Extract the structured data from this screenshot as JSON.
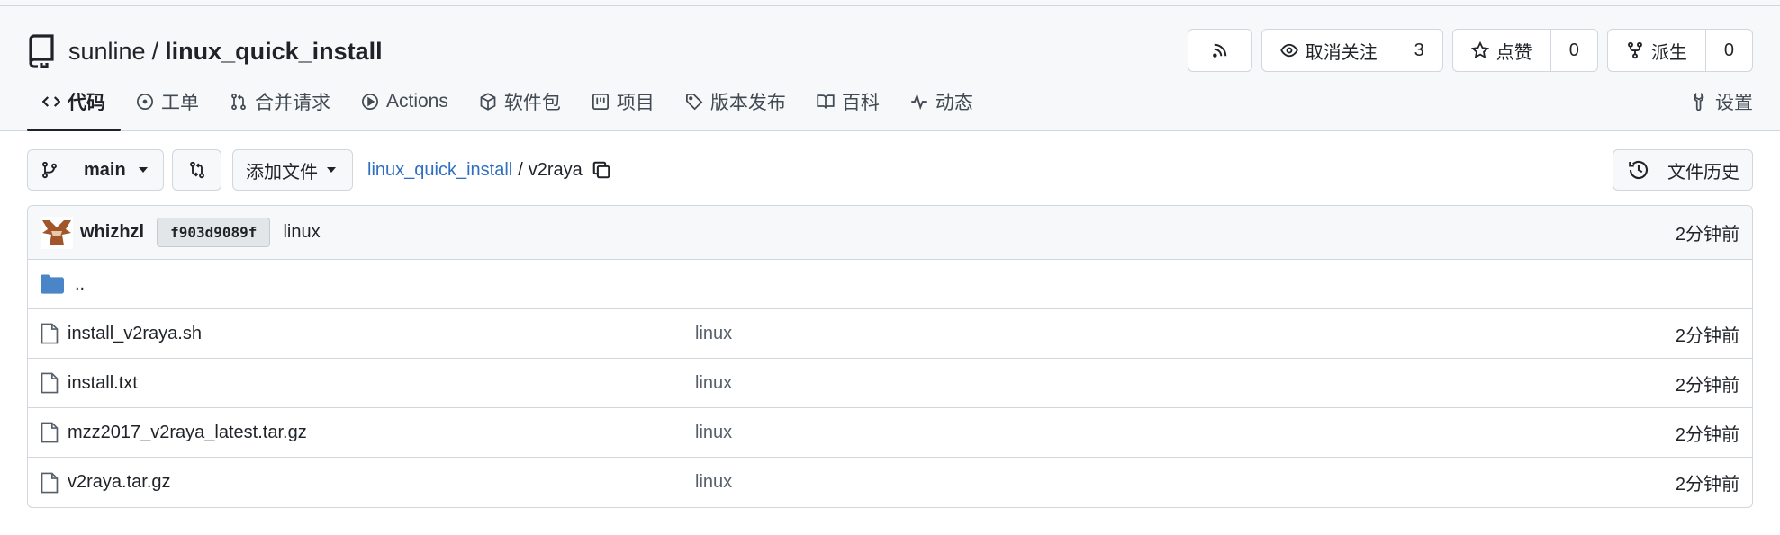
{
  "repo": {
    "owner": "sunline",
    "separator": "/",
    "name": "linux_quick_install"
  },
  "actions": {
    "unwatch_label": "取消关注",
    "watch_count": "3",
    "star_label": "点赞",
    "star_count": "0",
    "fork_label": "派生",
    "fork_count": "0"
  },
  "tabs": [
    {
      "label": "代码",
      "icon": "code-icon"
    },
    {
      "label": "工单",
      "icon": "issue-icon"
    },
    {
      "label": "合并请求",
      "icon": "pull-request-icon"
    },
    {
      "label": "Actions",
      "icon": "play-icon"
    },
    {
      "label": "软件包",
      "icon": "package-icon"
    },
    {
      "label": "项目",
      "icon": "project-icon"
    },
    {
      "label": "版本发布",
      "icon": "tag-icon"
    },
    {
      "label": "百科",
      "icon": "book-icon"
    },
    {
      "label": "动态",
      "icon": "pulse-icon"
    }
  ],
  "settings_label": "设置",
  "toolbar": {
    "branch": "main",
    "add_file_label": "添加文件",
    "breadcrumb_root": "linux_quick_install",
    "breadcrumb_sep": "/",
    "breadcrumb_current": "v2raya",
    "history_label": "文件历史"
  },
  "commit": {
    "author": "whizhzl",
    "sha": "f903d9089f",
    "message": "linux",
    "time": "2分钟前"
  },
  "parent_dir": "..",
  "files": [
    {
      "name": "install_v2raya.sh",
      "message": "linux",
      "time": "2分钟前"
    },
    {
      "name": "install.txt",
      "message": "linux",
      "time": "2分钟前"
    },
    {
      "name": "mzz2017_v2raya_latest.tar.gz",
      "message": "linux",
      "time": "2分钟前"
    },
    {
      "name": "v2raya.tar.gz",
      "message": "linux",
      "time": "2分钟前"
    }
  ],
  "colors": {
    "link": "#2f6fbf",
    "folder": "#4a86c7",
    "border": "#d0d7de"
  }
}
